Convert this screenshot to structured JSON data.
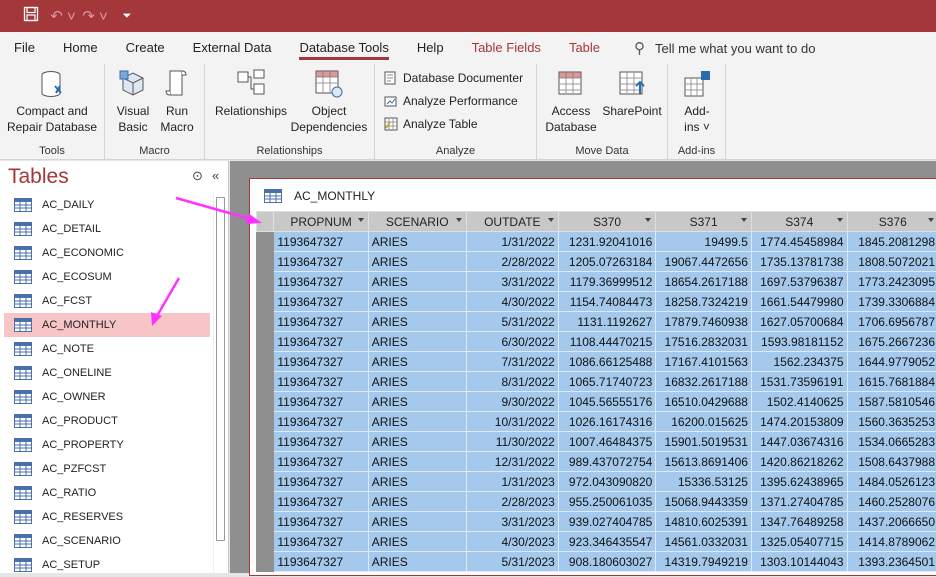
{
  "quick_access": {
    "save_icon": "save-icon",
    "undo_icon": "undo-icon",
    "redo_icon": "redo-icon",
    "customize_icon": "customize-qat-icon"
  },
  "menu": {
    "items": [
      "File",
      "Home",
      "Create",
      "External Data",
      "Database Tools",
      "Help",
      "Table Fields",
      "Table"
    ],
    "active": "Database Tools",
    "tell_me": "Tell me what you want to do"
  },
  "ribbon": {
    "tools": {
      "label": "Tools",
      "compact_l1": "Compact and",
      "compact_l2": "Repair Database"
    },
    "macro": {
      "label": "Macro",
      "vb_l1": "Visual",
      "vb_l2": "Basic",
      "run_l1": "Run",
      "run_l2": "Macro"
    },
    "relationships": {
      "label": "Relationships",
      "rel": "Relationships",
      "obj_l1": "Object",
      "obj_l2": "Dependencies"
    },
    "analyze": {
      "label": "Analyze",
      "documenter": "Database Documenter",
      "performance": "Analyze Performance",
      "table": "Analyze Table"
    },
    "move_data": {
      "label": "Move Data",
      "access_l1": "Access",
      "access_l2": "Database",
      "sharepoint": "SharePoint"
    },
    "addins": {
      "label": "Add-ins",
      "addins_l1": "Add-",
      "addins_l2": "ins ˅"
    }
  },
  "nav": {
    "title": "Tables",
    "tables": [
      "AC_DAILY",
      "AC_DETAIL",
      "AC_ECONOMIC",
      "AC_ECOSUM",
      "AC_FCST",
      "AC_MONTHLY",
      "AC_NOTE",
      "AC_ONELINE",
      "AC_OWNER",
      "AC_PRODUCT",
      "AC_PROPERTY",
      "AC_PZFCST",
      "AC_RATIO",
      "AC_RESERVES",
      "AC_SCENARIO",
      "AC_SETUP"
    ],
    "selected": "AC_MONTHLY"
  },
  "datasheet": {
    "tab_title": "AC_MONTHLY",
    "columns": [
      "PROPNUM",
      "SCENARIO",
      "OUTDATE",
      "S370",
      "S371",
      "S374",
      "S376"
    ],
    "rows": [
      [
        "1193647327",
        "ARIES",
        "1/31/2022",
        "1231.92041016",
        "19499.5",
        "1774.45458984",
        "1845.2081298"
      ],
      [
        "1193647327",
        "ARIES",
        "2/28/2022",
        "1205.07263184",
        "19067.4472656",
        "1735.13781738",
        "1808.5072021"
      ],
      [
        "1193647327",
        "ARIES",
        "3/31/2022",
        "1179.36999512",
        "18654.2617188",
        "1697.53796387",
        "1773.2423095"
      ],
      [
        "1193647327",
        "ARIES",
        "4/30/2022",
        "1154.74084473",
        "18258.7324219",
        "1661.54479980",
        "1739.3306884"
      ],
      [
        "1193647327",
        "ARIES",
        "5/31/2022",
        "1131.1192627",
        "17879.7460938",
        "1627.05700684",
        "1706.6956787"
      ],
      [
        "1193647327",
        "ARIES",
        "6/30/2022",
        "1108.44470215",
        "17516.2832031",
        "1593.98181152",
        "1675.2667236"
      ],
      [
        "1193647327",
        "ARIES",
        "7/31/2022",
        "1086.66125488",
        "17167.4101563",
        "1562.234375",
        "1644.9779052"
      ],
      [
        "1193647327",
        "ARIES",
        "8/31/2022",
        "1065.71740723",
        "16832.2617188",
        "1531.73596191",
        "1615.7681884"
      ],
      [
        "1193647327",
        "ARIES",
        "9/30/2022",
        "1045.56555176",
        "16510.0429688",
        "1502.4140625",
        "1587.5810546"
      ],
      [
        "1193647327",
        "ARIES",
        "10/31/2022",
        "1026.16174316",
        "16200.015625",
        "1474.20153809",
        "1560.3635253"
      ],
      [
        "1193647327",
        "ARIES",
        "11/30/2022",
        "1007.46484375",
        "15901.5019531",
        "1447.03674316",
        "1534.0665283"
      ],
      [
        "1193647327",
        "ARIES",
        "12/31/2022",
        "989.437072754",
        "15613.8691406",
        "1420.86218262",
        "1508.6437988"
      ],
      [
        "1193647327",
        "ARIES",
        "1/31/2023",
        "972.043090820",
        "15336.53125",
        "1395.62438965",
        "1484.0526123"
      ],
      [
        "1193647327",
        "ARIES",
        "2/28/2023",
        "955.250061035",
        "15068.9443359",
        "1371.27404785",
        "1460.2528076"
      ],
      [
        "1193647327",
        "ARIES",
        "3/31/2023",
        "939.027404785",
        "14810.6025391",
        "1347.76489258",
        "1437.2066650"
      ],
      [
        "1193647327",
        "ARIES",
        "4/30/2023",
        "923.346435547",
        "14561.0332031",
        "1325.05407715",
        "1414.8789062"
      ],
      [
        "1193647327",
        "ARIES",
        "5/31/2023",
        "908.180603027",
        "14319.7949219",
        "1303.10144043",
        "1393.2364501"
      ]
    ]
  },
  "colors": {
    "accent": "#a4373a",
    "selected_nav": "#f7c5c6",
    "cell_selected": "#a4c9ec",
    "annotation_arrow": "#ff33ff"
  }
}
